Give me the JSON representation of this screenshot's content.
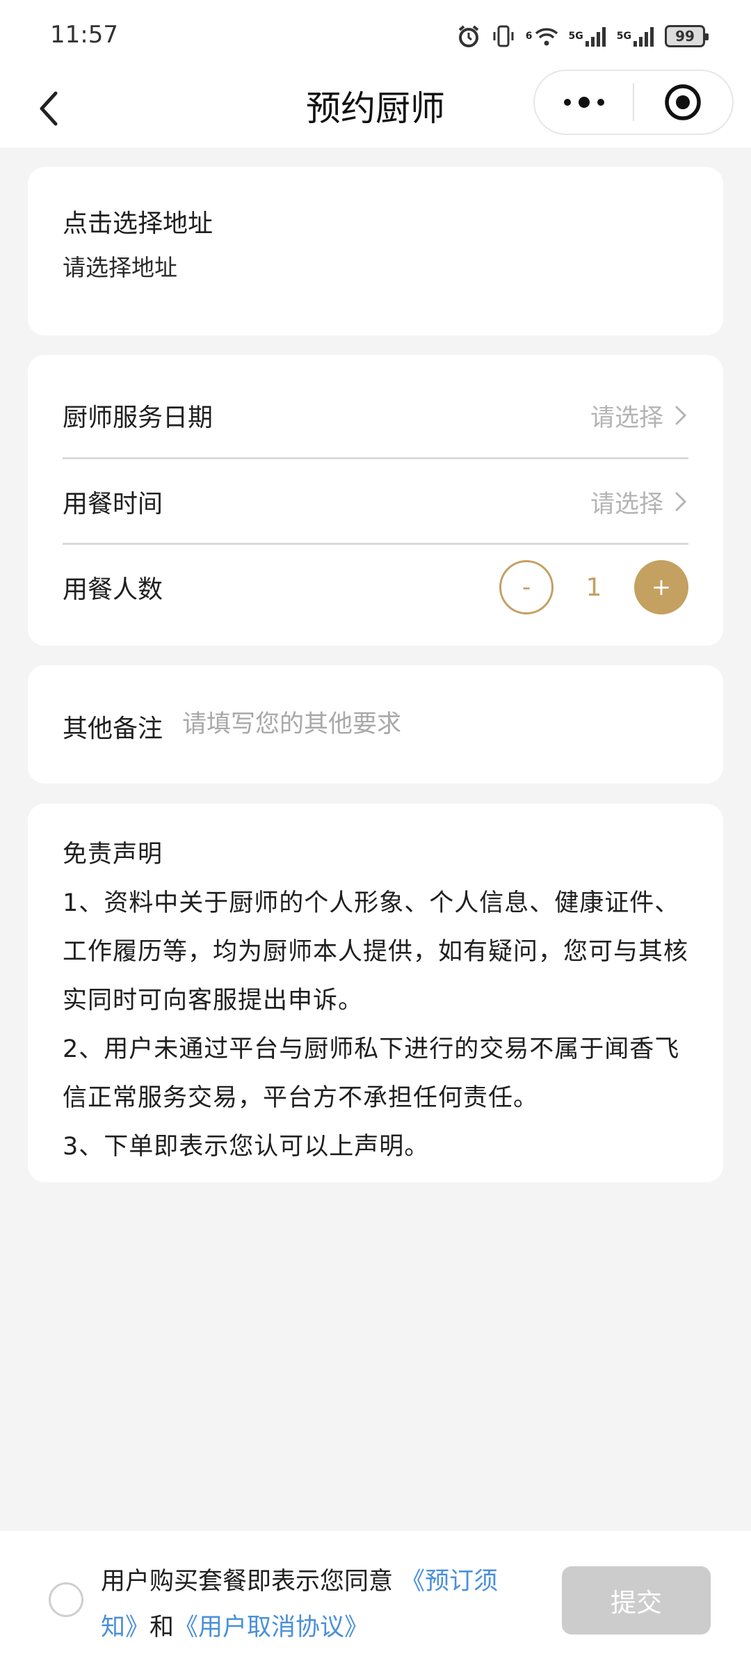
{
  "status_bar": {
    "time": "11:57",
    "network_1": "5G",
    "network_2": "5G",
    "wifi_label": "6",
    "battery": "99"
  },
  "nav": {
    "title": "预约厨师"
  },
  "address": {
    "title": "点击选择地址",
    "subtitle": "请选择地址"
  },
  "service": {
    "date_label": "厨师服务日期",
    "date_placeholder": "请选择",
    "time_label": "用餐时间",
    "time_placeholder": "请选择",
    "people_label": "用餐人数",
    "minus_label": "-",
    "people_count": "1",
    "plus_label": "+"
  },
  "notes": {
    "label": "其他备注",
    "placeholder": "请填写您的其他要求"
  },
  "disclaimer": {
    "title": "免责声明",
    "item1": "1、资料中关于厨师的个人形象、个人信息、健康证件、工作履历等，均为厨师本人提供，如有疑问，您可与其核实同时可向客服提出申诉。",
    "item2": "2、用户未通过平台与厨师私下进行的交易不属于闻香飞信正常服务交易，平台方不承担任何责任。",
    "item3": "3、下单即表示您认可以上声明。"
  },
  "footer": {
    "agree_prefix": "用户购买套餐即表示您同意",
    "link_booking": "《预订须知》",
    "and": "和",
    "link_cancel": "《用户取消协议》",
    "submit": "提交"
  },
  "colors": {
    "accent_gold": "#c4a061",
    "link_blue": "#4a90d9",
    "submit_disabled": "#cccccc"
  }
}
